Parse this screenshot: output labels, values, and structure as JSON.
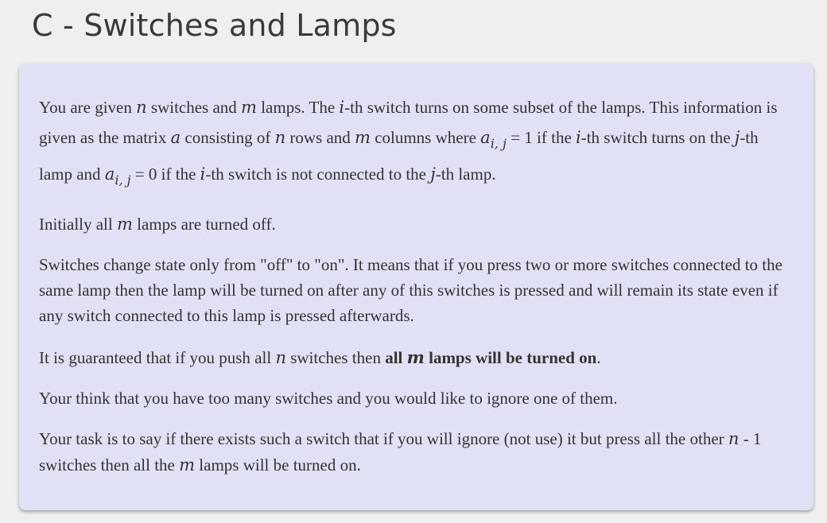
{
  "title": "C - Switches and Lamps",
  "statement": {
    "p1": {
      "t1": "You are given ",
      "n": "n",
      "t2": " switches and ",
      "m": "m",
      "t3": " lamps. The ",
      "i": "i",
      "t4": "-th switch turns on some subset of the lamps. This information is given as the matrix ",
      "a": "a",
      "t5": " consisting of ",
      "n2": "n",
      "t6": " rows and ",
      "m2": "m",
      "t7": " columns where ",
      "a_ij_base": "a",
      "a_ij_sub": "i, j",
      "t8": " = 1 if the ",
      "i2": "i",
      "t9": "-th switch turns on the ",
      "j": "j",
      "t10": "-th lamp and ",
      "a_ij2_base": "a",
      "a_ij2_sub": "i, j",
      "t11": " = 0 if the ",
      "i3": "i",
      "t12": "-th switch is not connected to the ",
      "j2": "j",
      "t13": "-th lamp."
    },
    "p2": {
      "t1": "Initially all ",
      "m": "m",
      "t2": " lamps are turned off."
    },
    "p3": "Switches change state only from \"off\" to \"on\". It means that if you press two or more switches connected to the same lamp then the lamp will be turned on after any of this switches is pressed and will remain its state even if any switch connected to this lamp is pressed afterwards.",
    "p4": {
      "t1": "It is guaranteed that if you push all ",
      "n": "n",
      "t2": " switches then ",
      "b1": "all ",
      "bm": "m",
      "b2": " lamps will be turned on",
      "t3": "."
    },
    "p5": "Your think that you have too many switches and you would like to ignore one of them.",
    "p6": {
      "t1": "Your task is to say if there exists such a switch that if you will ignore (not use) it but press all the other ",
      "n": "n",
      "t2": " - 1 switches then all the ",
      "m": "m",
      "t3": " lamps will be turned on."
    }
  }
}
